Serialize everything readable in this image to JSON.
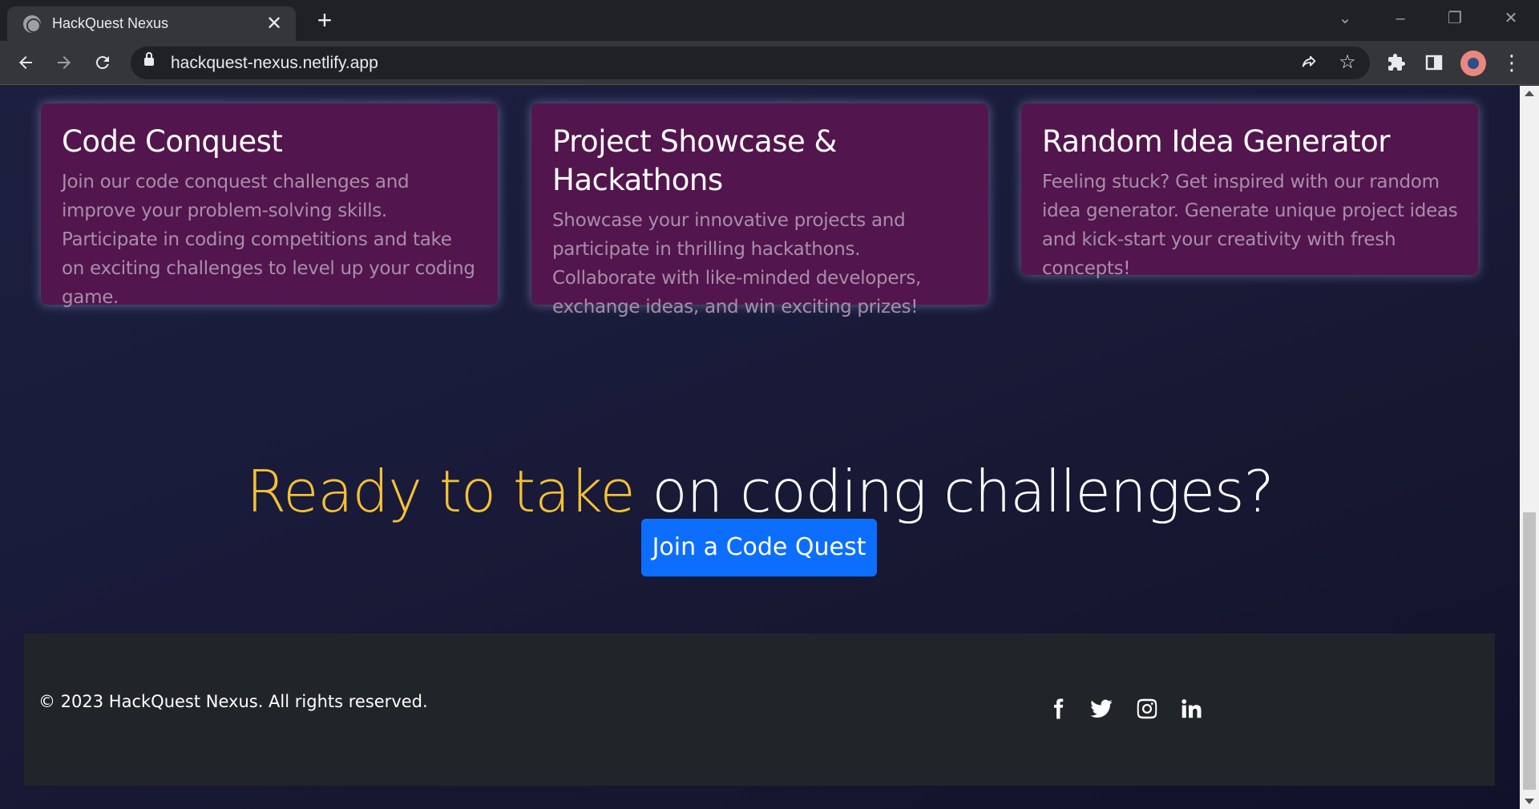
{
  "browser": {
    "tab_title": "HackQuest Nexus",
    "tab_close": "✕",
    "new_tab": "+",
    "url": "hackquest-nexus.netlify.app",
    "icons": {
      "back": "arrow-left-icon",
      "forward": "arrow-right-icon",
      "reload": "reload-icon",
      "share": "share-icon",
      "bookmark": "star-icon",
      "extensions": "puzzle-icon",
      "side_panel": "side-panel-icon",
      "menu": "kebab-menu-icon"
    }
  },
  "features": [
    {
      "title": "Code Conquest",
      "text": "Join our code conquest challenges and improve your problem-solving skills. Participate in coding competitions and take on exciting challenges to level up your coding game."
    },
    {
      "title": "Project Showcase & Hackathons",
      "text": "Showcase your innovative projects and participate in thrilling hackathons. Collaborate with like-minded developers, exchange ideas, and win exciting prizes!"
    },
    {
      "title": "Random Idea Generator",
      "text": "Feeling stuck? Get inspired with our random idea generator. Generate unique project ideas and kick-start your creativity with fresh concepts!"
    }
  ],
  "cta": {
    "heading_accent": "Ready to take",
    "heading_rest": " on coding challenges?",
    "button_label": "Join a Code Quest"
  },
  "footer": {
    "copyright": "© 2023 HackQuest Nexus. All rights reserved.",
    "social": [
      "facebook-icon",
      "twitter-icon",
      "instagram-icon",
      "linkedin-icon"
    ]
  },
  "colors": {
    "card_bg": "#53154d",
    "accent_yellow": "#f5c034",
    "button_blue": "#0d6efd",
    "footer_bg": "#212529"
  }
}
